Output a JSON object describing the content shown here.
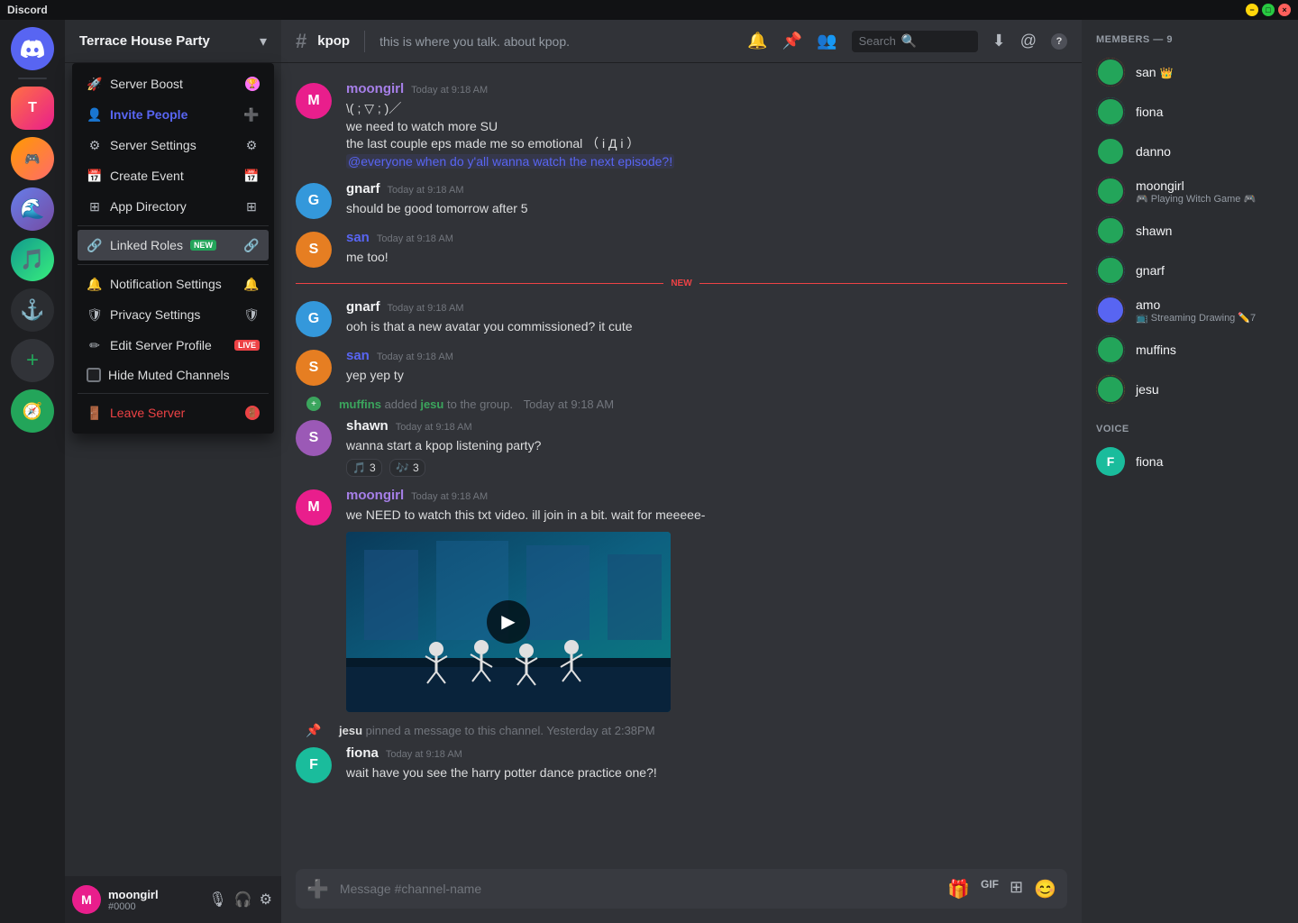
{
  "app": {
    "title": "Discord",
    "titlebar_controls": [
      "minimize",
      "maximize",
      "close"
    ]
  },
  "server": {
    "name": "Terrace House Party",
    "chevron": "▾"
  },
  "dropdown": {
    "items": [
      {
        "id": "server-boost",
        "label": "Server Boost",
        "icon": "boost",
        "color": "normal"
      },
      {
        "id": "invite-people",
        "label": "Invite People",
        "icon": "person-add",
        "color": "blue"
      },
      {
        "id": "server-settings",
        "label": "Server Settings",
        "icon": "gear",
        "color": "normal"
      },
      {
        "id": "create-event",
        "label": "Create Event",
        "icon": "calendar",
        "color": "normal"
      },
      {
        "id": "app-directory",
        "label": "App Directory",
        "icon": "grid",
        "color": "normal"
      },
      {
        "id": "linked-roles",
        "label": "Linked Roles",
        "icon": "link",
        "color": "normal",
        "badge": "NEW"
      },
      {
        "id": "notification-settings",
        "label": "Notification Settings",
        "icon": "bell",
        "color": "normal"
      },
      {
        "id": "privacy-settings",
        "label": "Privacy Settings",
        "icon": "shield",
        "color": "normal"
      },
      {
        "id": "edit-server-profile",
        "label": "Edit Server Profile",
        "icon": "pencil",
        "color": "normal"
      },
      {
        "id": "hide-muted-channels",
        "label": "Hide Muted Channels",
        "icon": "checkbox",
        "color": "normal"
      },
      {
        "id": "leave-server",
        "label": "Leave Server",
        "icon": "leave",
        "color": "red"
      }
    ]
  },
  "channel": {
    "hash": "#",
    "name": "kpop",
    "description": "this is where you talk. about kpop."
  },
  "search": {
    "placeholder": "Search"
  },
  "messages": [
    {
      "id": "msg1",
      "author": "moongirl",
      "author_color": "purple",
      "timestamp": "Today at 9:18 AM",
      "lines": [
        "\\( ; ▽ ; )／",
        "we need to watch more SU",
        "the last couple eps made me so emotional （ i Д i ）"
      ],
      "mention": "@everyone when do y'all wanna watch the next episode?!"
    },
    {
      "id": "msg2",
      "author": "gnarf",
      "author_color": "normal",
      "timestamp": "Today at 9:18 AM",
      "text": "should be good tomorrow after 5"
    },
    {
      "id": "msg3",
      "author": "san",
      "author_color": "blue",
      "timestamp": "Today at 9:18 AM",
      "text": "me too!"
    },
    {
      "id": "msg4",
      "author": "gnarf",
      "author_color": "normal",
      "timestamp": "Today at 9:18 AM",
      "text": "ooh is that a new avatar you commissioned? it cute",
      "new": true
    },
    {
      "id": "msg5",
      "author": "san",
      "author_color": "blue",
      "timestamp": "Today at 9:18 AM",
      "text": "yep yep ty"
    },
    {
      "id": "msg6",
      "type": "system",
      "text": "muffins added jesu to the group.",
      "timestamp": "Today at 9:18 AM"
    },
    {
      "id": "msg7",
      "author": "shawn",
      "author_color": "normal",
      "timestamp": "Today at 9:18 AM",
      "text": "wanna start a kpop listening party?",
      "reactions": [
        {
          "emoji": "🎵",
          "count": "3"
        },
        {
          "emoji": "🎶",
          "count": "3"
        }
      ]
    },
    {
      "id": "msg8",
      "author": "moongirl",
      "author_color": "purple",
      "timestamp": "Today at 9:18 AM",
      "text": "we NEED to watch this txt video. ill join in a bit. wait for meeeee-",
      "has_video": true
    },
    {
      "id": "msg9",
      "type": "pin",
      "text": "jesu pinned a message to this channel.",
      "timestamp": "Yesterday at 2:38PM"
    },
    {
      "id": "msg10",
      "author": "fiona",
      "author_color": "normal",
      "timestamp": "Today at 9:18 AM",
      "text": "wait have you see the harry potter dance practice one?!"
    }
  ],
  "input": {
    "placeholder": "Message #channel-name"
  },
  "members": {
    "header": "MEMBERS — 9",
    "list": [
      {
        "name": "san",
        "has_crown": true,
        "color": "av-orange"
      },
      {
        "name": "fiona",
        "color": "av-teal"
      },
      {
        "name": "danno",
        "color": "av-dark"
      },
      {
        "name": "moongirl",
        "status": "Playing Witch Game 🎮",
        "color": "av-pink"
      },
      {
        "name": "shawn",
        "color": "av-purple"
      },
      {
        "name": "gnarf",
        "color": "av-blue"
      },
      {
        "name": "amo",
        "status": "Streaming Drawing ✏️7",
        "color": "av-red"
      },
      {
        "name": "muffins",
        "color": "av-green"
      },
      {
        "name": "jesu",
        "color": "av-yellow"
      }
    ]
  },
  "user": {
    "name": "moongirl",
    "discriminator": "#0000",
    "color": "av-pink"
  },
  "icons": {
    "boost": "🚀",
    "person-add": "👤+",
    "gear": "⚙️",
    "calendar": "📅",
    "grid": "⊞",
    "link": "🔗",
    "bell": "🔔",
    "shield": "🛡️",
    "pencil": "✏️",
    "leave": "🚪",
    "hash": "#",
    "bell-header": "🔔",
    "pin": "📌",
    "people": "👥",
    "magnify": "🔍",
    "download": "⬇",
    "at": "@",
    "question": "?",
    "mic": "🎙",
    "headset": "🎧",
    "settings": "⚙",
    "plus-circle": "+",
    "gift": "🎁",
    "gif": "GIF",
    "apps": "⊞",
    "emoji": "😊"
  }
}
